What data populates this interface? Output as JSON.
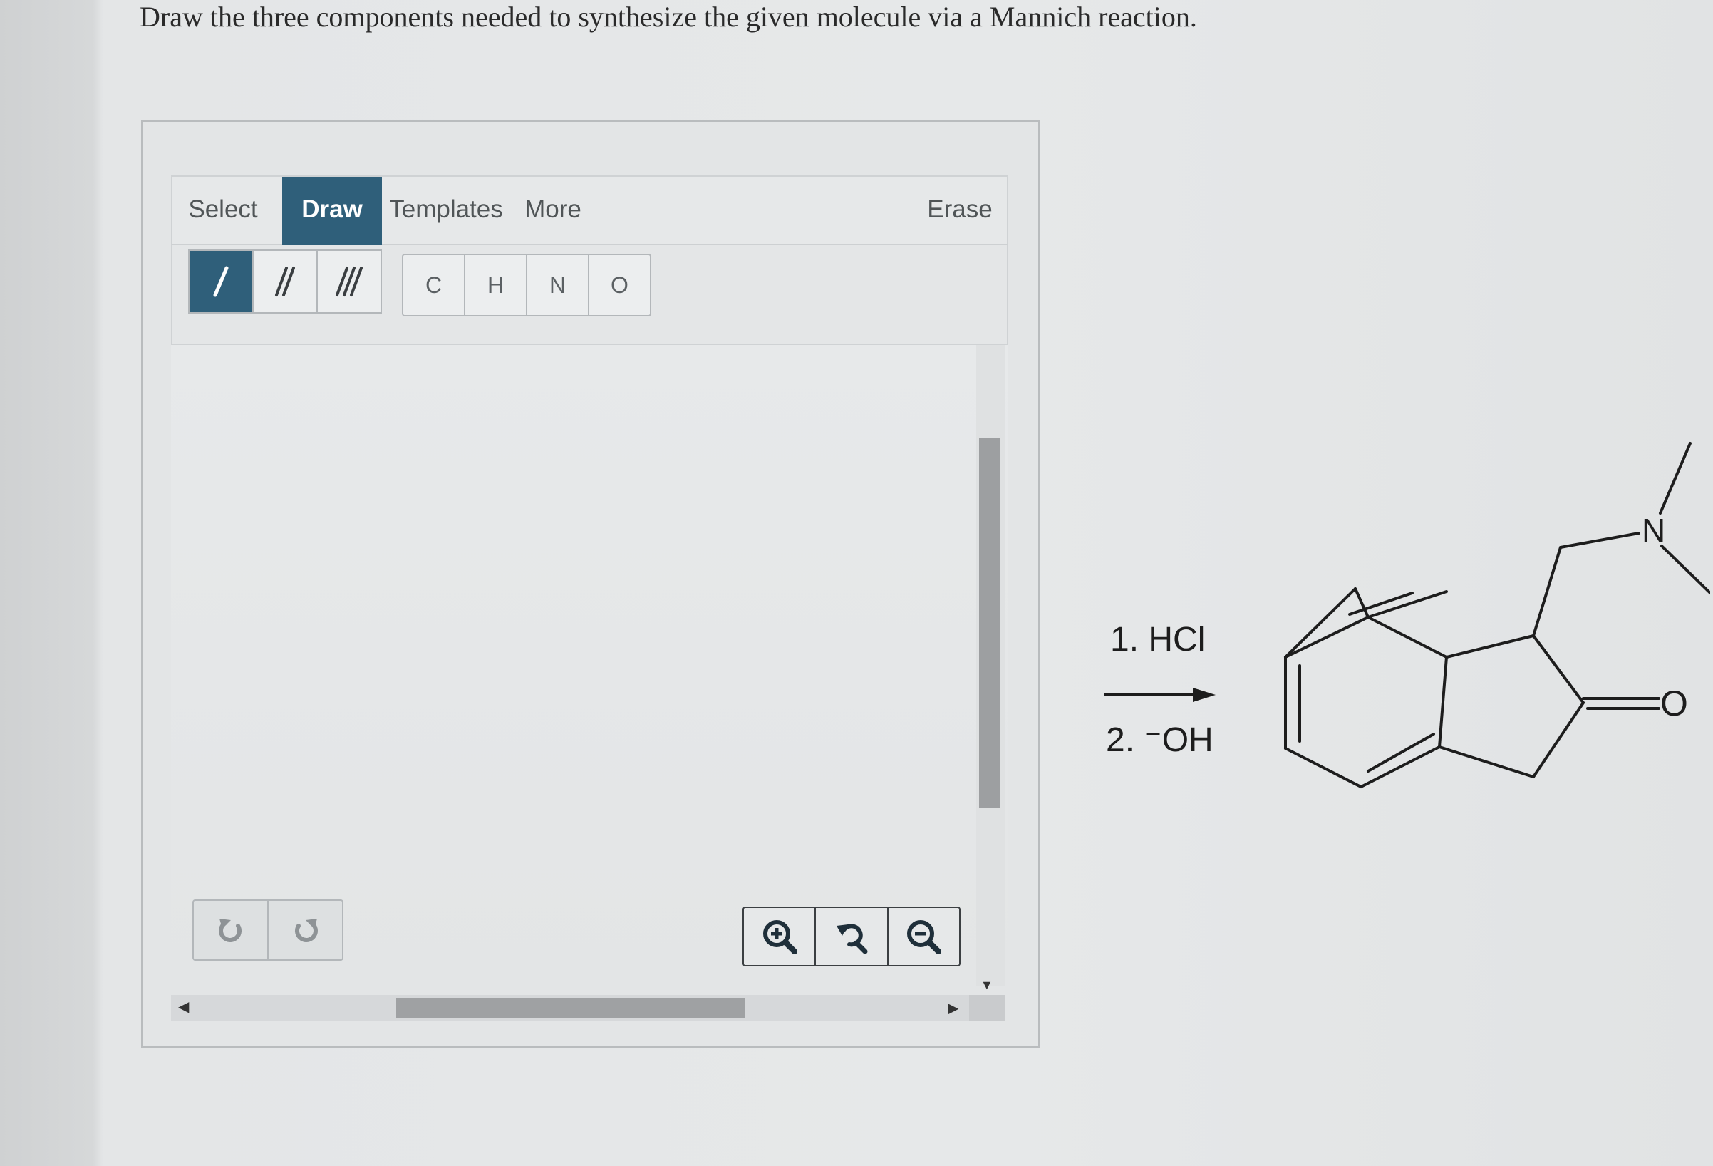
{
  "question": {
    "text": "Draw the three components needed to synthesize the given molecule via a Mannich reaction."
  },
  "toolbar": {
    "tabs": [
      {
        "label": "Select"
      },
      {
        "label": "Draw"
      },
      {
        "label": "Templates"
      },
      {
        "label": "More"
      }
    ],
    "active_tab": "Draw",
    "erase_label": "Erase",
    "bonds": [
      "single-bond-icon",
      "double-bond-icon",
      "triple-bond-icon"
    ],
    "active_bond": "single-bond-icon",
    "atoms": [
      "C",
      "H",
      "N",
      "O"
    ]
  },
  "canvas_controls": {
    "undo_icon": "undo-icon",
    "redo_icon": "redo-icon",
    "zoom_in_icon": "zoom-in-icon",
    "zoom_reset_icon": "zoom-reset-icon",
    "zoom_out_icon": "zoom-out-icon"
  },
  "reaction": {
    "step1": "1. HCl",
    "step2": "2. ⁻OH",
    "atom_labels": {
      "nitrogen": "N",
      "oxygen": "O"
    }
  },
  "colors": {
    "accent": "#2f5f7a",
    "background": "#e6e8e9"
  }
}
